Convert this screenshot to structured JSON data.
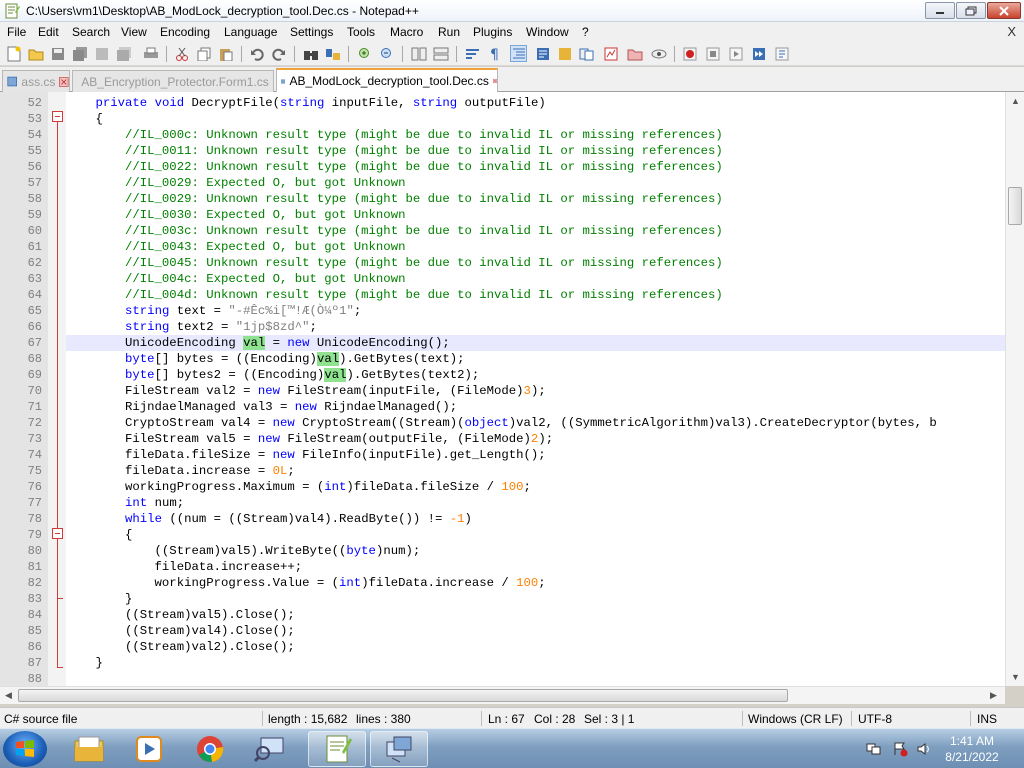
{
  "window": {
    "title": "C:\\Users\\vm1\\Desktop\\AB_ModLock_decryption_tool.Dec.cs - Notepad++",
    "menu_close": "X"
  },
  "menu": {
    "items": [
      "File",
      "Edit",
      "Search",
      "View",
      "Encoding",
      "Language",
      "Settings",
      "Tools",
      "Macro",
      "Run",
      "Plugins",
      "Window",
      "?"
    ]
  },
  "tabs": [
    {
      "label": "ass.cs",
      "active": false
    },
    {
      "label": "AB_Encryption_Protector.Form1.cs",
      "active": false
    },
    {
      "label": "AB_ModLock_decryption_tool.Dec.cs",
      "active": true
    }
  ],
  "code": {
    "current_line": 67,
    "lines": [
      {
        "no": "52",
        "tokens": [
          [
            "tx",
            "    "
          ],
          [
            "kw",
            "private"
          ],
          [
            "tx",
            " "
          ],
          [
            "kw",
            "void"
          ],
          [
            "tx",
            " DecryptFile("
          ],
          [
            "kw",
            "string"
          ],
          [
            "tx",
            " inputFile, "
          ],
          [
            "kw",
            "string"
          ],
          [
            "tx",
            " outputFile)"
          ]
        ]
      },
      {
        "no": "53",
        "tokens": [
          [
            "tx",
            "    {"
          ]
        ]
      },
      {
        "no": "54",
        "tokens": [
          [
            "cm",
            "        //IL_000c: Unknown result type (might be due to invalid IL or missing references)"
          ]
        ]
      },
      {
        "no": "55",
        "tokens": [
          [
            "cm",
            "        //IL_0011: Unknown result type (might be due to invalid IL or missing references)"
          ]
        ]
      },
      {
        "no": "56",
        "tokens": [
          [
            "cm",
            "        //IL_0022: Unknown result type (might be due to invalid IL or missing references)"
          ]
        ]
      },
      {
        "no": "57",
        "tokens": [
          [
            "cm",
            "        //IL_0029: Expected O, but got Unknown"
          ]
        ]
      },
      {
        "no": "58",
        "tokens": [
          [
            "cm",
            "        //IL_0029: Unknown result type (might be due to invalid IL or missing references)"
          ]
        ]
      },
      {
        "no": "59",
        "tokens": [
          [
            "cm",
            "        //IL_0030: Expected O, but got Unknown"
          ]
        ]
      },
      {
        "no": "60",
        "tokens": [
          [
            "cm",
            "        //IL_003c: Unknown result type (might be due to invalid IL or missing references)"
          ]
        ]
      },
      {
        "no": "61",
        "tokens": [
          [
            "cm",
            "        //IL_0043: Expected O, but got Unknown"
          ]
        ]
      },
      {
        "no": "62",
        "tokens": [
          [
            "cm",
            "        //IL_0045: Unknown result type (might be due to invalid IL or missing references)"
          ]
        ]
      },
      {
        "no": "63",
        "tokens": [
          [
            "cm",
            "        //IL_004c: Expected O, but got Unknown"
          ]
        ]
      },
      {
        "no": "64",
        "tokens": [
          [
            "cm",
            "        //IL_004d: Unknown result type (might be due to invalid IL or missing references)"
          ]
        ]
      },
      {
        "no": "65",
        "tokens": [
          [
            "tx",
            "        "
          ],
          [
            "kw",
            "string"
          ],
          [
            "tx",
            " text = "
          ],
          [
            "st",
            "\"-#Êc%i[™!Æ(Ò¼º1\""
          ],
          [
            "tx",
            ";"
          ]
        ]
      },
      {
        "no": "66",
        "tokens": [
          [
            "tx",
            "        "
          ],
          [
            "kw",
            "string"
          ],
          [
            "tx",
            " text2 = "
          ],
          [
            "st",
            "\"1jp$8zd^\""
          ],
          [
            "tx",
            ";"
          ]
        ]
      },
      {
        "no": "67",
        "tokens": [
          [
            "tx",
            "        UnicodeEncoding "
          ],
          [
            "hl",
            "val"
          ],
          [
            "tx",
            " = "
          ],
          [
            "kw",
            "new"
          ],
          [
            "tx",
            " UnicodeEncoding();"
          ]
        ]
      },
      {
        "no": "68",
        "tokens": [
          [
            "tx",
            "        "
          ],
          [
            "kw",
            "byte"
          ],
          [
            "tx",
            "[] bytes = ((Encoding)"
          ],
          [
            "hl",
            "val"
          ],
          [
            "tx",
            ").GetBytes(text);"
          ]
        ]
      },
      {
        "no": "69",
        "tokens": [
          [
            "tx",
            "        "
          ],
          [
            "kw",
            "byte"
          ],
          [
            "tx",
            "[] bytes2 = ((Encoding)"
          ],
          [
            "hl",
            "val"
          ],
          [
            "tx",
            ").GetBytes(text2);"
          ]
        ]
      },
      {
        "no": "70",
        "tokens": [
          [
            "tx",
            "        FileStream val2 = "
          ],
          [
            "kw",
            "new"
          ],
          [
            "tx",
            " FileStream(inputFile, (FileMode)"
          ],
          [
            "nm",
            "3"
          ],
          [
            "tx",
            ");"
          ]
        ]
      },
      {
        "no": "71",
        "tokens": [
          [
            "tx",
            "        RijndaelManaged val3 = "
          ],
          [
            "kw",
            "new"
          ],
          [
            "tx",
            " RijndaelManaged();"
          ]
        ]
      },
      {
        "no": "72",
        "tokens": [
          [
            "tx",
            "        CryptoStream val4 = "
          ],
          [
            "kw",
            "new"
          ],
          [
            "tx",
            " CryptoStream((Stream)("
          ],
          [
            "kw",
            "object"
          ],
          [
            "tx",
            ")val2, ((SymmetricAlgorithm)val3).CreateDecryptor(bytes, b"
          ]
        ]
      },
      {
        "no": "73",
        "tokens": [
          [
            "tx",
            "        FileStream val5 = "
          ],
          [
            "kw",
            "new"
          ],
          [
            "tx",
            " FileStream(outputFile, (FileMode)"
          ],
          [
            "nm",
            "2"
          ],
          [
            "tx",
            ");"
          ]
        ]
      },
      {
        "no": "74",
        "tokens": [
          [
            "tx",
            "        fileData.fileSize = "
          ],
          [
            "kw",
            "new"
          ],
          [
            "tx",
            " FileInfo(inputFile).get_Length();"
          ]
        ]
      },
      {
        "no": "75",
        "tokens": [
          [
            "tx",
            "        fileData.increase = "
          ],
          [
            "nm",
            "0L"
          ],
          [
            "tx",
            ";"
          ]
        ]
      },
      {
        "no": "76",
        "tokens": [
          [
            "tx",
            "        workingProgress.Maximum = ("
          ],
          [
            "kw",
            "int"
          ],
          [
            "tx",
            ")fileData.fileSize / "
          ],
          [
            "nm",
            "100"
          ],
          [
            "tx",
            ";"
          ]
        ]
      },
      {
        "no": "77",
        "tokens": [
          [
            "tx",
            "        "
          ],
          [
            "kw",
            "int"
          ],
          [
            "tx",
            " num;"
          ]
        ]
      },
      {
        "no": "78",
        "tokens": [
          [
            "tx",
            "        "
          ],
          [
            "kw",
            "while"
          ],
          [
            "tx",
            " ((num = ((Stream)val4).ReadByte()) != "
          ],
          [
            "nm",
            "-1"
          ],
          [
            "tx",
            ")"
          ]
        ]
      },
      {
        "no": "79",
        "tokens": [
          [
            "tx",
            "        {"
          ]
        ]
      },
      {
        "no": "80",
        "tokens": [
          [
            "tx",
            "            ((Stream)val5).WriteByte(("
          ],
          [
            "kw",
            "byte"
          ],
          [
            "tx",
            ")num);"
          ]
        ]
      },
      {
        "no": "81",
        "tokens": [
          [
            "tx",
            "            fileData.increase++;"
          ]
        ]
      },
      {
        "no": "82",
        "tokens": [
          [
            "tx",
            "            workingProgress.Value = ("
          ],
          [
            "kw",
            "int"
          ],
          [
            "tx",
            ")fileData.increase / "
          ],
          [
            "nm",
            "100"
          ],
          [
            "tx",
            ";"
          ]
        ]
      },
      {
        "no": "83",
        "tokens": [
          [
            "tx",
            "        }"
          ]
        ]
      },
      {
        "no": "84",
        "tokens": [
          [
            "tx",
            "        ((Stream)val5).Close();"
          ]
        ]
      },
      {
        "no": "85",
        "tokens": [
          [
            "tx",
            "        ((Stream)val4).Close();"
          ]
        ]
      },
      {
        "no": "86",
        "tokens": [
          [
            "tx",
            "        ((Stream)val2).Close();"
          ]
        ]
      },
      {
        "no": "87",
        "tokens": [
          [
            "tx",
            "    }"
          ]
        ]
      },
      {
        "no": "88",
        "tokens": [
          [
            "tx",
            ""
          ]
        ]
      }
    ]
  },
  "status": {
    "file_type": "C# source file",
    "length": "length : 15,682",
    "lines": "lines : 380",
    "ln": "Ln : 67",
    "col": "Col : 28",
    "sel": "Sel : 3 | 1",
    "eol": "Windows (CR LF)",
    "encoding": "UTF-8",
    "mode": "INS"
  },
  "taskbar": {
    "time": "1:41 AM",
    "date": "8/21/2022"
  },
  "colors": {
    "keyword": "#0000ff",
    "comment": "#008000",
    "string": "#808080",
    "number": "#ff8000",
    "highlight": "#8fe28f",
    "current_line": "#e8e8ff",
    "active_tab_accent": "#f0a33a"
  }
}
